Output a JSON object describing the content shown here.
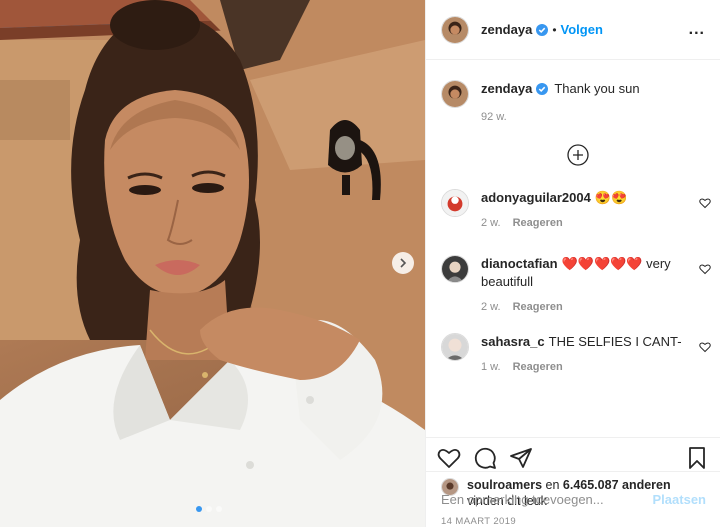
{
  "header": {
    "username": "zendaya",
    "separator": "•",
    "follow_label": "Volgen",
    "more_label": "..."
  },
  "caption": {
    "username": "zendaya",
    "text": "Thank you sun",
    "time": "92 w."
  },
  "comments": [
    {
      "username": "adonyaguilar2004",
      "text": "😍😍",
      "time": "2 w.",
      "reply_label": "Reageren"
    },
    {
      "username": "dianoctafian",
      "text": "❤️❤️❤️❤️❤️ very beautifull",
      "time": "2 w.",
      "reply_label": "Reageren"
    },
    {
      "username": "sahasra_c",
      "text": "THE SELFIES I CANT-",
      "time": "1 w.",
      "reply_label": "Reageren"
    }
  ],
  "likes": {
    "liker": "soulroamers",
    "connector": "en",
    "count": "6.465.087 anderen",
    "suffix": "vinden dit leuk"
  },
  "date": "14 MAART 2019",
  "comment_box": {
    "placeholder": "Een opmerking toevoegen...",
    "post_label": "Plaatsen"
  },
  "carousel": {
    "slide_count": 3,
    "active_index": 0
  },
  "colors": {
    "accent": "#0095f6",
    "verified": "#3897f0",
    "muted": "#8e8e8e",
    "post_disabled": "#b2dffc"
  }
}
